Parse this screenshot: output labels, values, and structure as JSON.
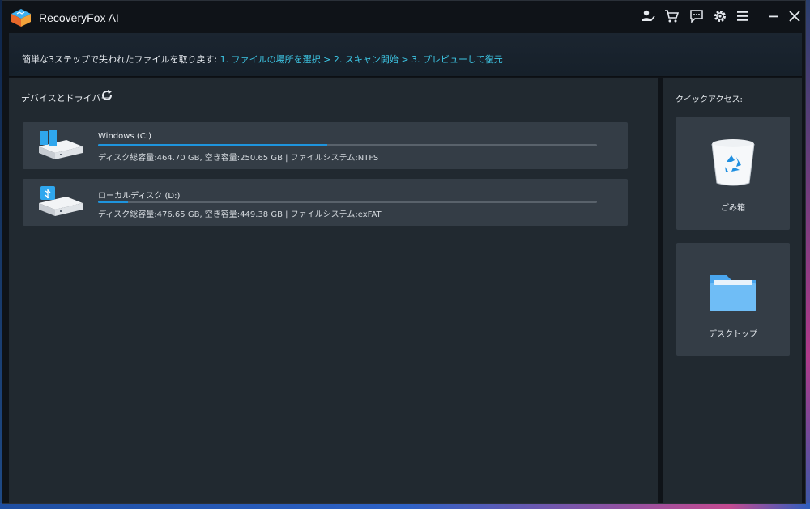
{
  "window": {
    "title": "RecoveryFox AI"
  },
  "titlebar_icons": [
    {
      "name": "account-icon"
    },
    {
      "name": "cart-icon"
    },
    {
      "name": "feedback-icon"
    },
    {
      "name": "settings-icon"
    },
    {
      "name": "menu-icon"
    },
    {
      "name": "minimize-icon"
    },
    {
      "name": "close-icon"
    }
  ],
  "info_bar": {
    "prefix": "簡単な3ステップで失われたファイルを取り戻す:",
    "steps": "1. ファイルの場所を選択 > 2. スキャン開始 > 3. プレビューして復元"
  },
  "devices": {
    "title": "デバイスとドライバー",
    "drives": [
      {
        "name": "Windows (C:)",
        "details": "ディスク総容量:464.70 GB, 空き容量:250.65 GB | ファイルシステム:NTFS",
        "used_fraction": 0.46,
        "icon": "windows-drive-icon"
      },
      {
        "name": "ローカルディスク (D:)",
        "details": "ディスク総容量:476.65 GB, 空き容量:449.38 GB | ファイルシステム:exFAT",
        "used_fraction": 0.06,
        "icon": "usb-drive-icon"
      }
    ]
  },
  "quick_access": {
    "title": "クイックアクセス:",
    "items": [
      {
        "label": "ごみ箱",
        "icon": "recycle-bin-icon"
      },
      {
        "label": "デスクトップ",
        "icon": "folder-icon"
      }
    ]
  },
  "colors": {
    "accent": "#1e94dd",
    "steps_text": "#3ec9e8",
    "panel_bg": "#212930",
    "card_bg": "#343d46",
    "window_bg": "#0f1318"
  }
}
